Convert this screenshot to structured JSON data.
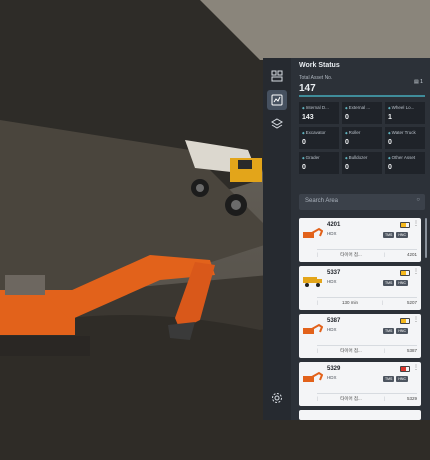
{
  "panel": {
    "title": "Work Status",
    "total_label": "Total Asset No.",
    "total_value": "147",
    "total_icon_text": "1",
    "stats": [
      {
        "label": "Internal D...",
        "value": "143"
      },
      {
        "label": "External ...",
        "value": "0"
      },
      {
        "label": "Wheel Lo...",
        "value": "1"
      },
      {
        "label": "Excavator",
        "value": "0"
      },
      {
        "label": "Roller",
        "value": "0"
      },
      {
        "label": "Water Truck",
        "value": "0"
      },
      {
        "label": "Grader",
        "value": "0"
      },
      {
        "label": "Bulldozer",
        "value": "0"
      },
      {
        "label": "Other Asset",
        "value": "0"
      }
    ],
    "search_placeholder": "Search Area",
    "cards": [
      {
        "id": "4201",
        "type": "HDX",
        "info": "타이어 점...",
        "code": "4201",
        "battery": 0.6,
        "battery_color": "#f5b81c"
      },
      {
        "id": "5337",
        "type": "HDX",
        "info": "130 min",
        "code": "5207",
        "battery": 0.6,
        "battery_color": "#f5b81c"
      },
      {
        "id": "5387",
        "type": "HDX",
        "info": "타이어 점...",
        "code": "5387",
        "battery": 0.6,
        "battery_color": "#f5b81c"
      },
      {
        "id": "5329",
        "type": "HDX",
        "info": "타이어 점...",
        "code": "5329",
        "battery": 0.6,
        "battery_color": "#d9352b"
      }
    ],
    "tag1": "TMS",
    "tag2": "HNC"
  },
  "colors": {
    "accent": "#3f8c9a",
    "panel_bg": "#2c3138",
    "excavator": "#e2621b"
  }
}
